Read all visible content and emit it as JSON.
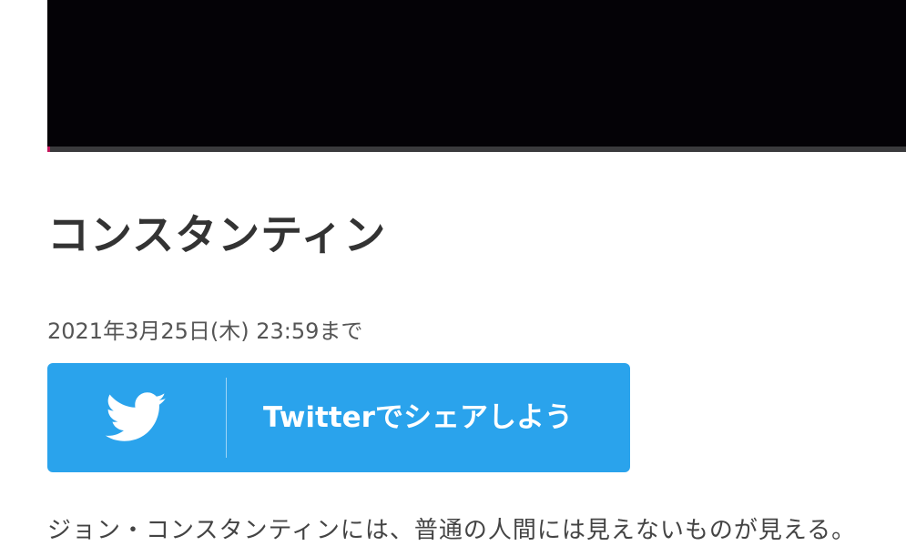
{
  "video": {
    "progress": 0.003
  },
  "program": {
    "title": "コンスタンティン",
    "deadline": "2021年3月25日(木) 23:59まで",
    "synopsis": "ジョン・コンスタンティンには、普通の人間には見えないものが見える。"
  },
  "share": {
    "label": "Twitterでシェアしよう",
    "icon": "twitter-bird-icon",
    "color": "#2aa3ec"
  },
  "colors": {
    "accent": "#c2185b",
    "text": "#333333"
  }
}
